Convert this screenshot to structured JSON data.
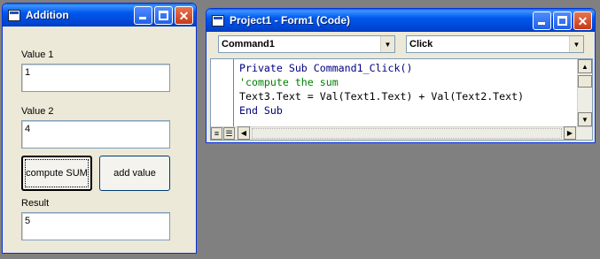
{
  "addition_form": {
    "title": "Addition",
    "value1_label": "Value 1",
    "value1": "1",
    "value2_label": "Value 2",
    "value2": "4",
    "compute_button": "compute SUM",
    "add_button": "add value",
    "result_label": "Result",
    "result": "5"
  },
  "code_window": {
    "title": "Project1 - Form1 (Code)",
    "object_combo": "Command1",
    "procedure_combo": "Click",
    "code_lines": [
      "Private Sub Command1_Click()",
      "'compute the sum",
      "Text3.Text = Val(Text1.Text) + Val(Text2.Text)",
      "End Sub"
    ]
  },
  "colors": {
    "desktop": "#808080",
    "titlebar": "#0058ee",
    "comment": "#008000",
    "keyword": "#00007f"
  }
}
